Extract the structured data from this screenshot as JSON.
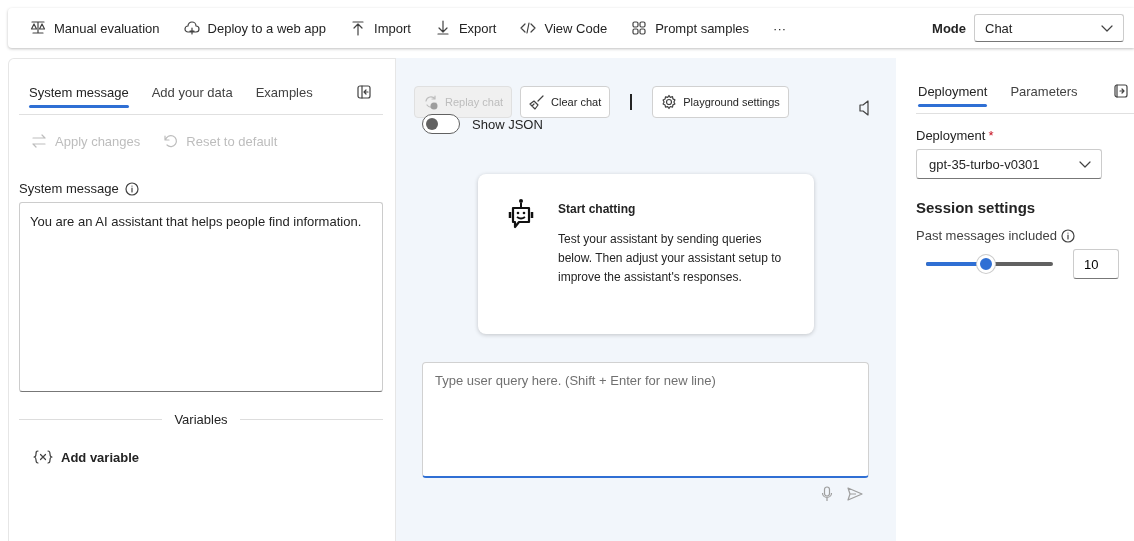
{
  "toolbar": {
    "items": [
      {
        "label": "Manual evaluation"
      },
      {
        "label": "Deploy to a web app"
      },
      {
        "label": "Import"
      },
      {
        "label": "Export"
      },
      {
        "label": "View Code"
      },
      {
        "label": "Prompt samples"
      },
      {
        "label": "···"
      }
    ],
    "mode": {
      "label": "Mode",
      "value": "Chat"
    }
  },
  "left_panel": {
    "tabs": [
      {
        "label": "System message",
        "selected": true
      },
      {
        "label": "Add your data",
        "selected": false
      },
      {
        "label": "Examples",
        "selected": false
      }
    ],
    "actions": [
      {
        "label": "Apply changes",
        "disabled": true
      },
      {
        "label": "Reset to default",
        "disabled": true
      }
    ],
    "system_message": {
      "label": "System message",
      "value": "You are an AI assistant that helps people find information."
    },
    "variables": {
      "label": "Variables"
    },
    "add_variable": {
      "label": "Add variable"
    }
  },
  "chat": {
    "buttons": [
      {
        "label": "Replay chat",
        "disabled": true
      },
      {
        "label": "Clear chat",
        "disabled": false
      },
      {
        "label": "Playground settings",
        "disabled": false
      }
    ],
    "show_json": {
      "label": "Show JSON",
      "on": false
    },
    "welcome": {
      "title": "Start chatting",
      "text": "Test your assistant by sending queries below. Then adjust your assistant setup to improve the assistant's responses."
    },
    "input": {
      "placeholder": "Type user query here. (Shift + Enter for new line)"
    }
  },
  "right_panel": {
    "tabs": [
      {
        "label": "Deployment",
        "selected": true
      },
      {
        "label": "Parameters",
        "selected": false
      }
    ],
    "deployment": {
      "label": "Deployment",
      "required_mark": "*",
      "value": "gpt-35-turbo-v0301"
    },
    "session_settings": {
      "title": "Session settings",
      "past_messages": {
        "label": "Past messages included",
        "level": 0.47,
        "value": "10"
      }
    }
  }
}
